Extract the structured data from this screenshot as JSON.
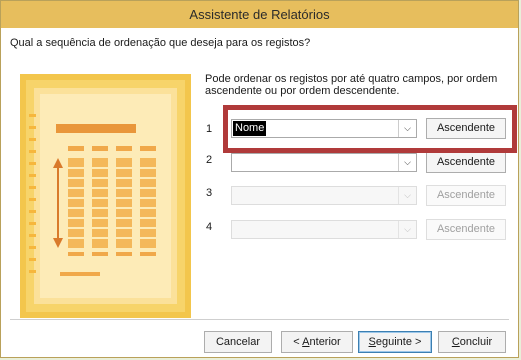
{
  "window": {
    "title": "Assistente de Relatórios"
  },
  "question": "Qual a sequência de ordenação que deseja para os registos?",
  "instruction": "Pode ordenar os registos por até quatro campos, por ordem ascendente ou por ordem descendente.",
  "sort_rows": [
    {
      "number": "1",
      "field_value": "Nome",
      "order_label": "Ascendente",
      "enabled": true
    },
    {
      "number": "2",
      "field_value": "",
      "order_label": "Ascendente",
      "enabled": true
    },
    {
      "number": "3",
      "field_value": "",
      "order_label": "Ascendente",
      "enabled": false
    },
    {
      "number": "4",
      "field_value": "",
      "order_label": "Ascendente",
      "enabled": false
    }
  ],
  "buttons": {
    "cancel": "Cancelar",
    "back_pre": "< ",
    "back_accel": "A",
    "back_rest": "nterior",
    "next_accel": "S",
    "next_rest": "eguinte >",
    "finish_accel": "C",
    "finish_rest": "oncluir"
  },
  "colors": {
    "title_bar": "#e7be5d",
    "highlight_box": "#b03a3a",
    "illustration_bg": "#f3c64c"
  },
  "icons": {
    "dropdown": "chevron-down-icon",
    "illustration": "report-sort-illustration"
  }
}
